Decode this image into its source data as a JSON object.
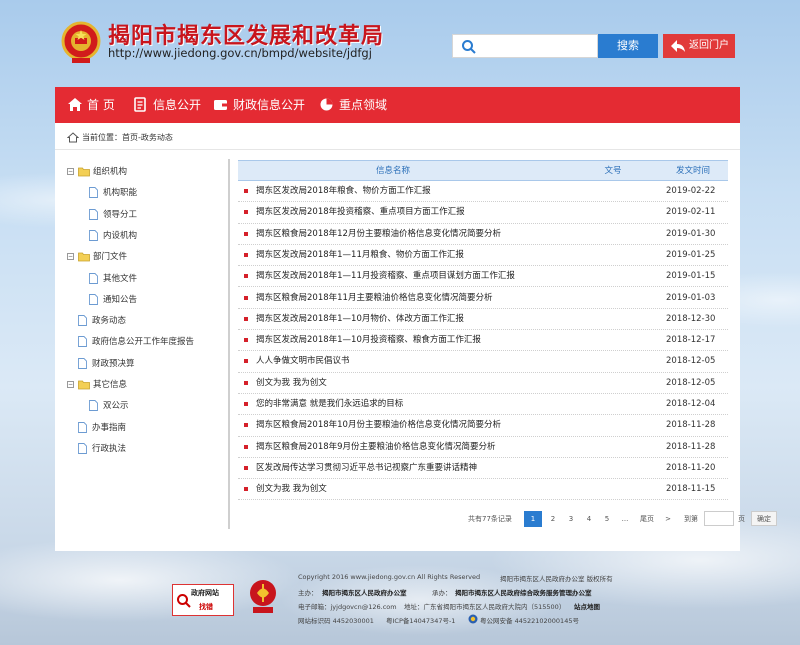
{
  "header": {
    "title": "揭阳市揭东区发展和改革局",
    "url": "http://www.jiedong.gov.cn/bmpd/website/jdfgj",
    "search_placeholder": "",
    "search_button": "搜索",
    "return_button": "返回门户"
  },
  "nav": {
    "items": [
      {
        "label": "首 页",
        "icon": "home-icon"
      },
      {
        "label": "信息公开",
        "icon": "document-icon"
      },
      {
        "label": "财政信息公开",
        "icon": "wallet-icon"
      },
      {
        "label": "重点领域",
        "icon": "pie-icon"
      }
    ]
  },
  "breadcrumb": "当前位置：首页-政务动态",
  "sidebar": {
    "items": [
      {
        "label": "组织机构",
        "level": 0,
        "folder": true
      },
      {
        "label": "机构职能",
        "level": 1
      },
      {
        "label": "领导分工",
        "level": 1
      },
      {
        "label": "内设机构",
        "level": 1
      },
      {
        "label": "部门文件",
        "level": 0,
        "folder": true
      },
      {
        "label": "其他文件",
        "level": 1
      },
      {
        "label": "通知公告",
        "level": 1
      },
      {
        "label": "政务动态",
        "level": 0
      },
      {
        "label": "政府信息公开工作年度报告",
        "level": 0
      },
      {
        "label": "财政预决算",
        "level": 0
      },
      {
        "label": "其它信息",
        "level": 0,
        "folder": true
      },
      {
        "label": "双公示",
        "level": 1
      },
      {
        "label": "办事指南",
        "level": 0
      },
      {
        "label": "行政执法",
        "level": 0
      }
    ]
  },
  "table": {
    "headers": [
      "信息名称",
      "文号",
      "发文时间"
    ],
    "rows": [
      {
        "title": "揭东区发改局2018年粮食、物价方面工作汇报",
        "date": "2019-02-22"
      },
      {
        "title": "揭东区发改局2018年投资稽察、重点项目方面工作汇报",
        "date": "2019-02-11"
      },
      {
        "title": "揭东区粮食局2018年12月份主要粮油价格信息变化情况简要分析",
        "date": "2019-01-30"
      },
      {
        "title": "揭东区发改局2018年1—11月粮食、物价方面工作汇报",
        "date": "2019-01-25"
      },
      {
        "title": "揭东区发改局2018年1—11月投资稽察、重点项目谋划方面工作汇报",
        "date": "2019-01-15"
      },
      {
        "title": "揭东区粮食局2018年11月主要粮油价格信息变化情况简要分析",
        "date": "2019-01-03"
      },
      {
        "title": "揭东区发改局2018年1—10月物价、体改方面工作汇报",
        "date": "2018-12-30"
      },
      {
        "title": "揭东区发改局2018年1—10月投资稽察、粮食方面工作汇报",
        "date": "2018-12-17"
      },
      {
        "title": "人人争做文明市民倡议书",
        "date": "2018-12-05"
      },
      {
        "title": "创文为我 我为创文",
        "date": "2018-12-05"
      },
      {
        "title": "您的非常满意 就是我们永远追求的目标",
        "date": "2018-12-04"
      },
      {
        "title": "揭东区粮食局2018年10月份主要粮油价格信息变化情况简要分析",
        "date": "2018-11-28"
      },
      {
        "title": "揭东区粮食局2018年9月份主要粮油价格信息变化情况简要分析",
        "date": "2018-11-28"
      },
      {
        "title": "区发改局传达学习贯彻习近平总书记视察广东重要讲话精神",
        "date": "2018-11-20"
      },
      {
        "title": "创文为我 我为创文",
        "date": "2018-11-15"
      }
    ]
  },
  "pager": {
    "total": "共有77条记录",
    "pages": [
      "1",
      "2",
      "3",
      "4",
      "5",
      "...",
      "尾页",
      ">"
    ],
    "current": "1",
    "goto_prefix": "到第",
    "goto_suffix": "页",
    "go_button": "确定"
  },
  "footer": {
    "badge_line1": "政府网站",
    "badge_line2": "找错",
    "line1a": "Copyright 2016 www.jiedong.gov.cn All Rights Reserved",
    "line1b": "揭阳市揭东区人民政府办公室  版权所有",
    "line2a": "主办：",
    "line2b": "揭阳市揭东区人民政府办公室",
    "line2c": "承办：",
    "line2d": "揭阳市揭东区人民政府综合政务服务管理办公室",
    "line3a": "电子邮箱：jyjdgovcn@126.com",
    "line3b": "地址：广东省揭阳市揭东区人民政府大院内（515500）",
    "line3c": "站点地图",
    "line4a": "网站标识码 4452030001",
    "line4b": "粤ICP备14047347号-1",
    "line4c": "粤公网安备 44522102000145号"
  },
  "colors": {
    "brand_red": "#e42b33",
    "title_red": "#c8151d",
    "link_blue": "#2a7cd0"
  }
}
